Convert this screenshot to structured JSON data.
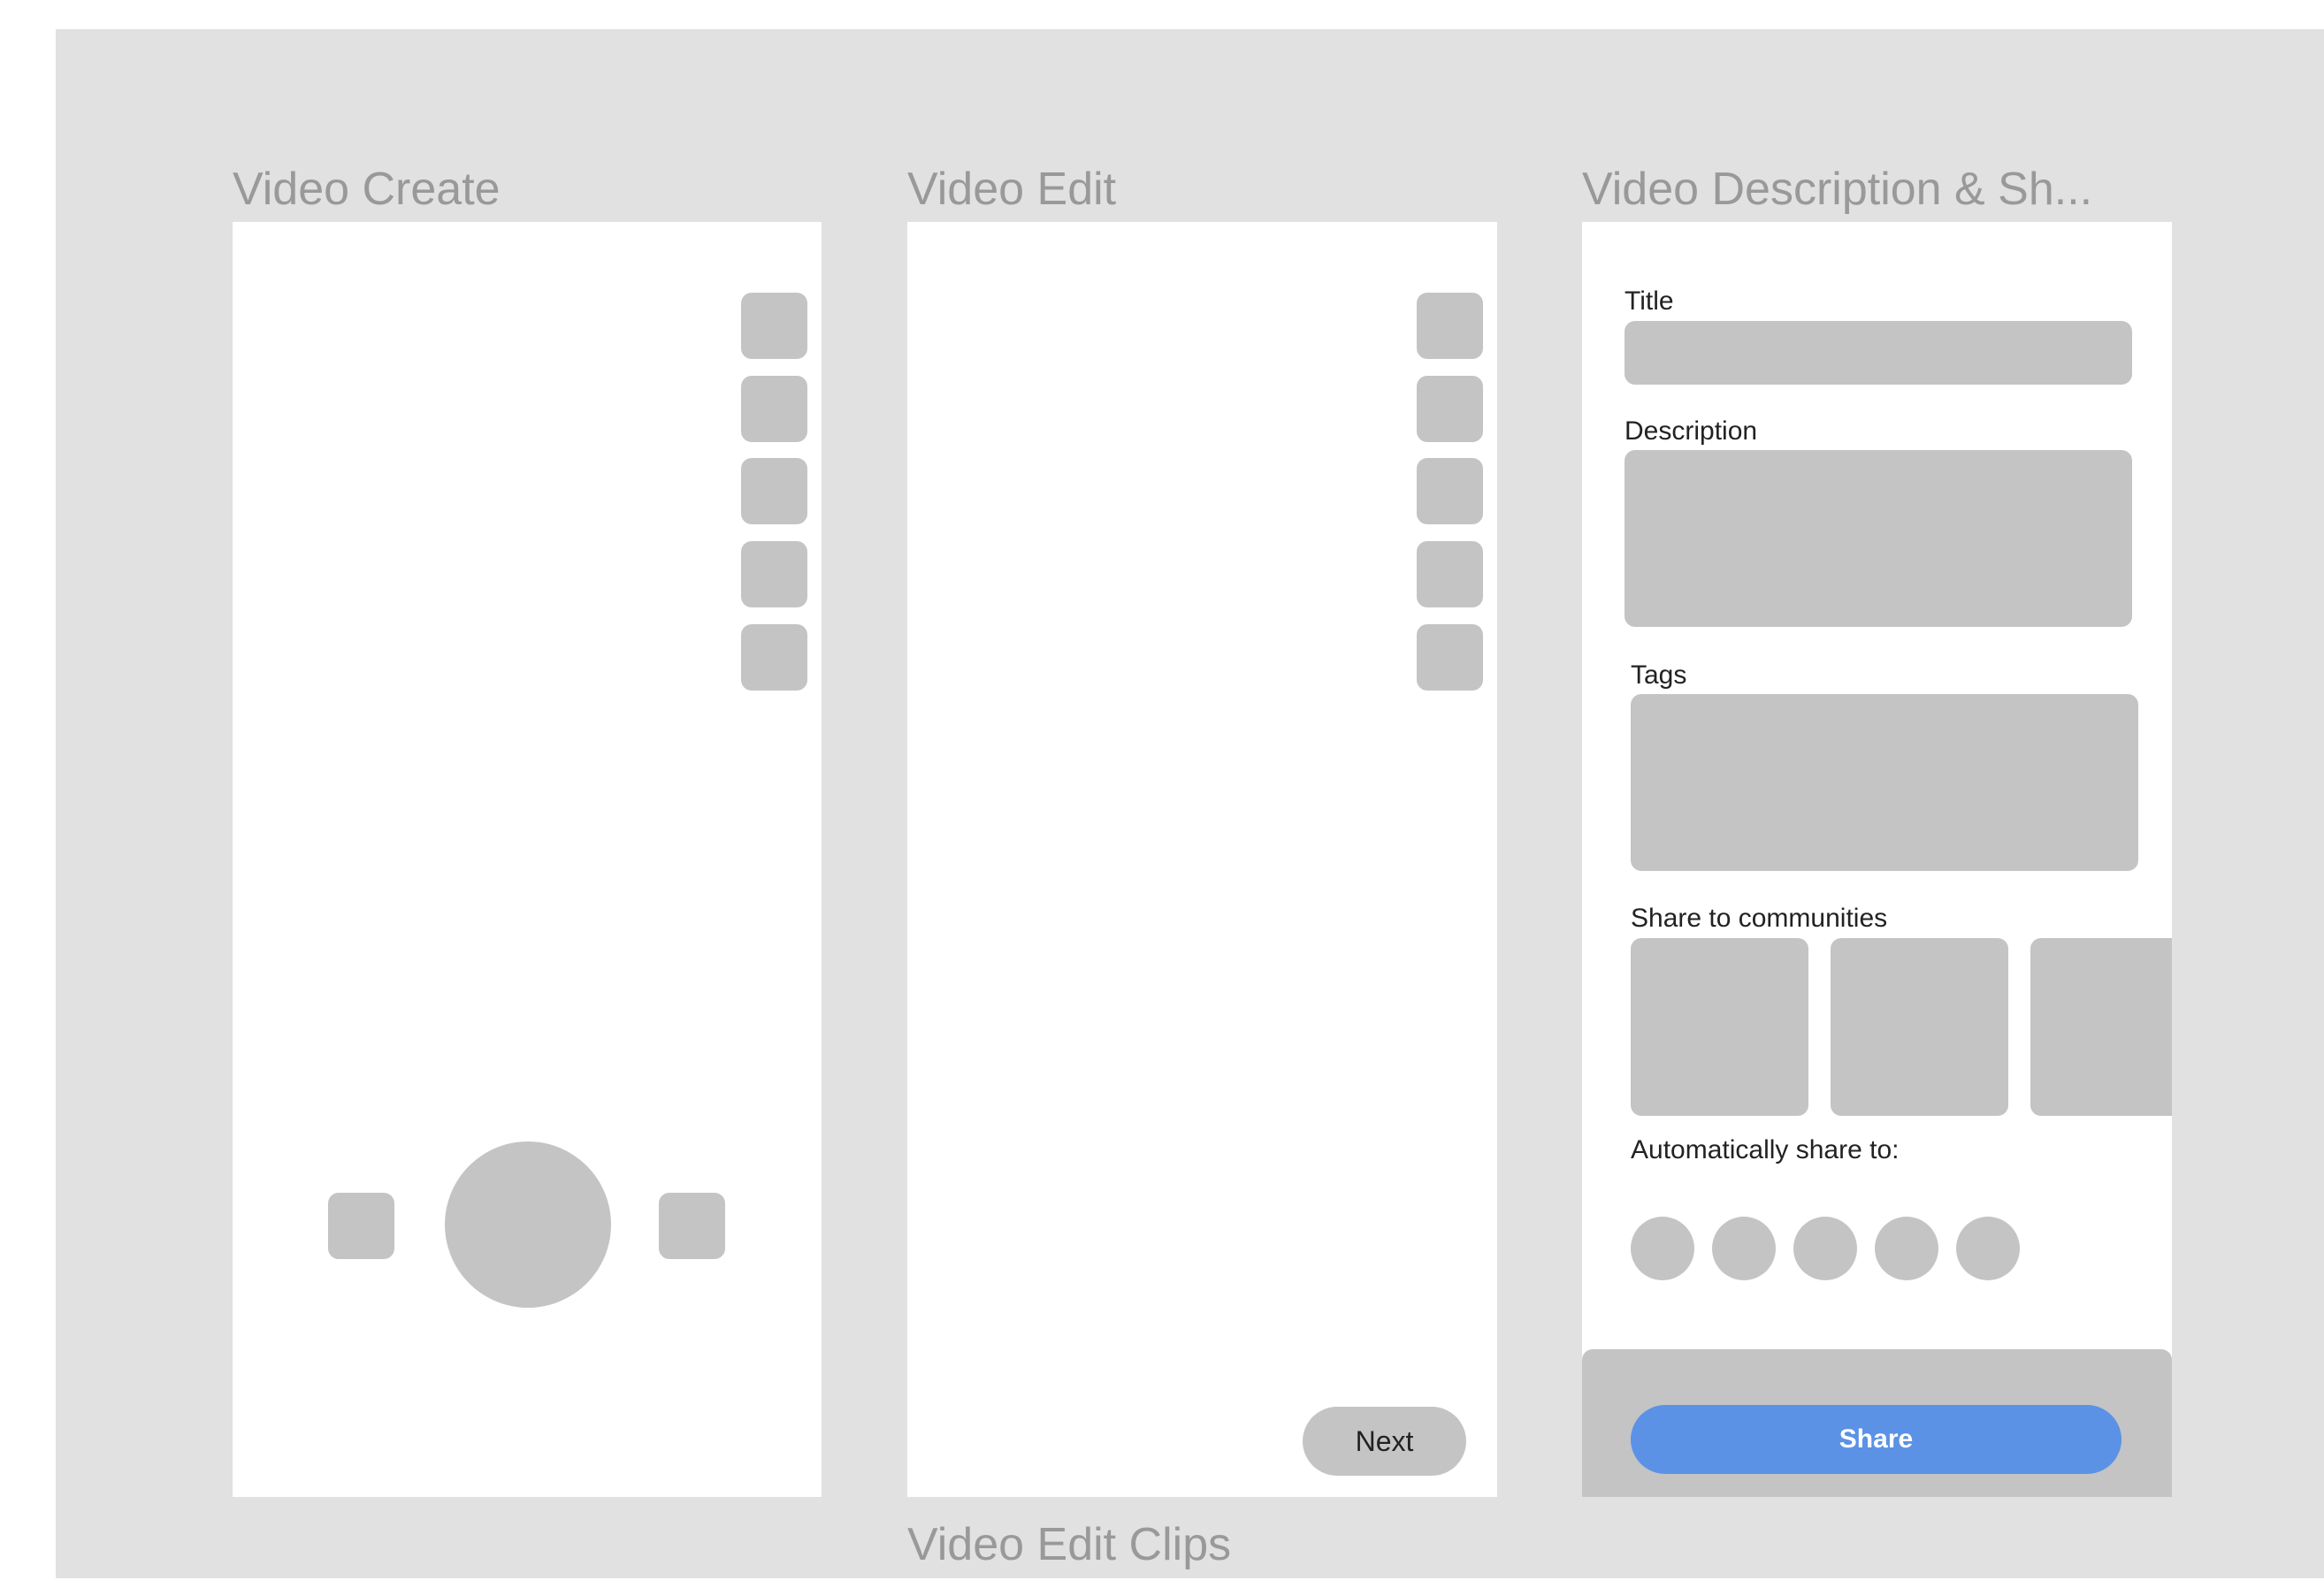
{
  "frames": {
    "video_create": {
      "title": "Video Create"
    },
    "video_edit": {
      "title": "Video Edit",
      "next_label": "Next"
    },
    "video_description": {
      "title": "Video Description & Sh...",
      "title_label": "Title",
      "description_label": "Description",
      "tags_label": "Tags",
      "communities_label": "Share to communities",
      "auto_share_label": "Automatically share to:",
      "share_label": "Share"
    },
    "video_edit_clips": {
      "title": "Video Edit Clips"
    }
  },
  "colors": {
    "canvas": "#e1e1e1",
    "frame": "#ffffff",
    "placeholder": "#c4c4c4",
    "frame_title": "#999999",
    "share_button": "#5b92e5"
  }
}
